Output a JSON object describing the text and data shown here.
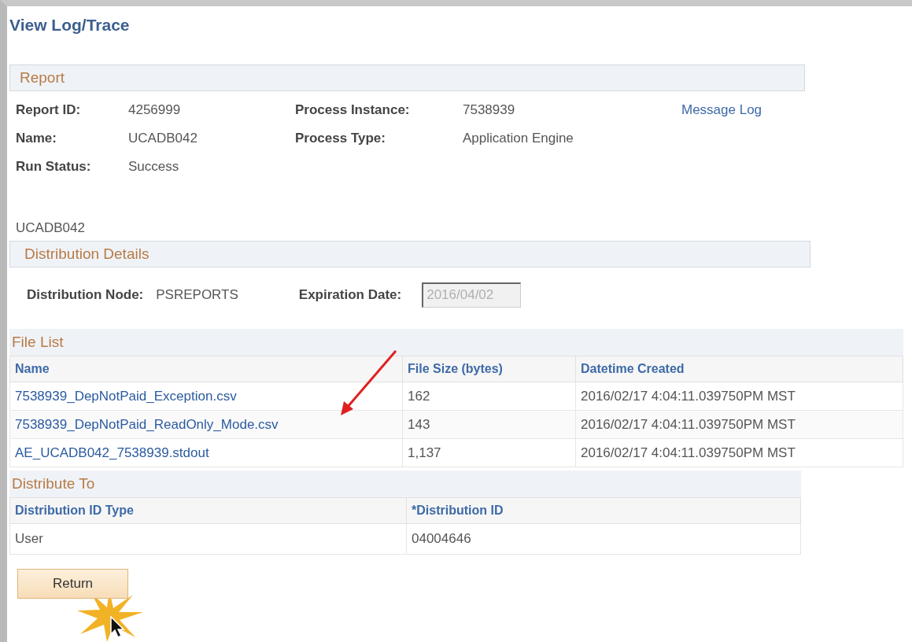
{
  "page": {
    "title": "View Log/Trace"
  },
  "report": {
    "heading": "Report",
    "rows": [
      {
        "label": "Report ID:",
        "value": "4256999",
        "label2": "Process Instance:",
        "value2": "7538939",
        "link": "Message Log"
      },
      {
        "label": "Name:",
        "value": "UCADB042",
        "label2": "Process Type:",
        "value2": "Application Engine"
      },
      {
        "label": "Run Status:",
        "value": "Success"
      }
    ]
  },
  "report_name": "UCADB042",
  "distribution_details": {
    "heading": "Distribution Details",
    "node_label": "Distribution Node:",
    "node_value": "PSREPORTS",
    "expiration_label": "Expiration Date:",
    "expiration_value": "2016/04/02",
    "expiration_disabled": true
  },
  "file_list": {
    "heading": "File List",
    "columns": [
      "Name",
      "File Size (bytes)",
      "Datetime Created"
    ],
    "rows": [
      [
        "7538939_DepNotPaid_Exception.csv",
        "162",
        "2016/02/17  4:04:11.039750PM MST"
      ],
      [
        "7538939_DepNotPaid_ReadOnly_Mode.csv",
        "143",
        "2016/02/17  4:04:11.039750PM MST"
      ],
      [
        "AE_UCADB042_7538939.stdout",
        "1,137",
        "2016/02/17  4:04:11.039750PM MST"
      ]
    ]
  },
  "distribute_to": {
    "heading": "Distribute To",
    "columns": [
      "Distribution ID Type",
      "*Distribution ID"
    ],
    "rows": [
      [
        "User",
        "04004646"
      ]
    ]
  },
  "buttons": [
    {
      "label": "Return",
      "highlighted": true
    }
  ]
}
